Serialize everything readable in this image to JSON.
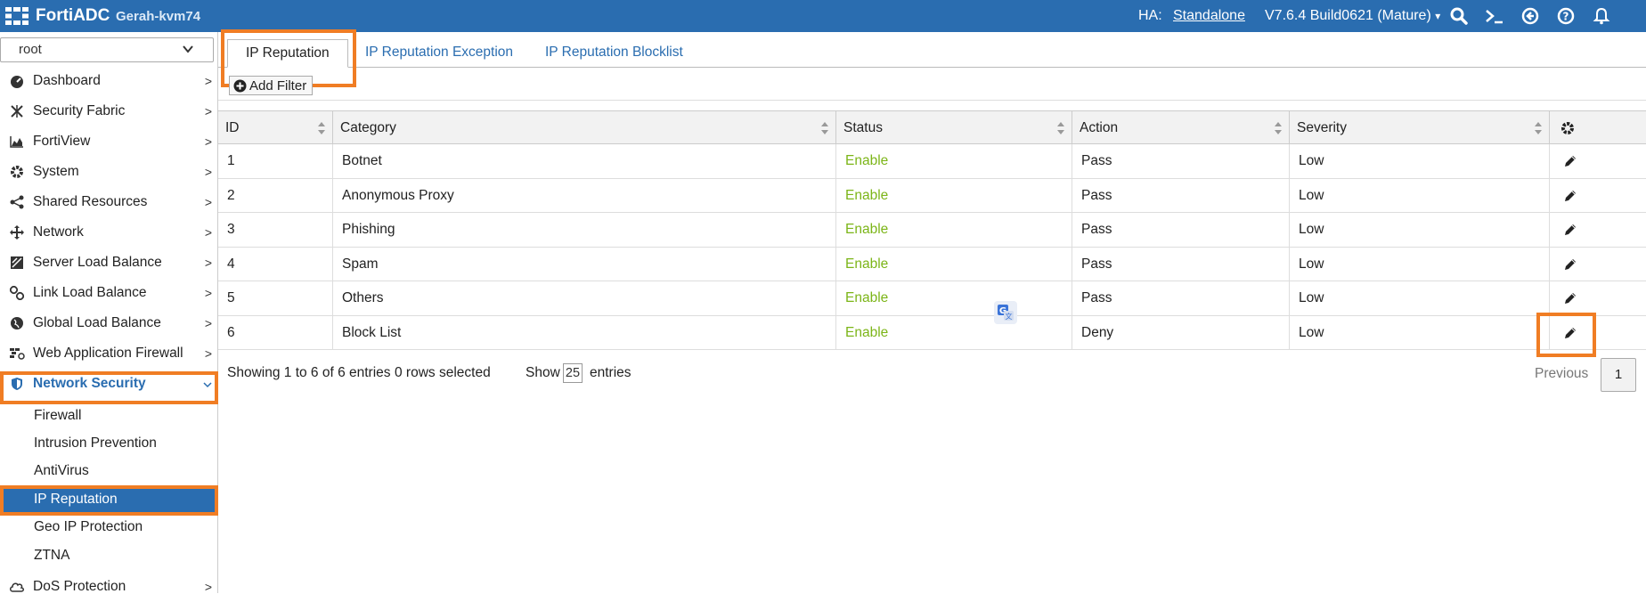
{
  "app": {
    "brand": "FortiADC",
    "hostname": "Gerah-kvm74"
  },
  "header": {
    "ha_label": "HA:",
    "ha_value": "Standalone",
    "version": "V7.6.4 Build0621 (Mature)",
    "version_caret": "▾"
  },
  "sidebar": {
    "vdom": "root",
    "items": [
      {
        "label": "Dashboard",
        "icon": "dashboard-icon"
      },
      {
        "label": "Security Fabric",
        "icon": "security-fabric-icon"
      },
      {
        "label": "FortiView",
        "icon": "chart-icon"
      },
      {
        "label": "System",
        "icon": "gear-icon"
      },
      {
        "label": "Shared Resources",
        "icon": "share-icon"
      },
      {
        "label": "Network",
        "icon": "network-icon"
      },
      {
        "label": "Server Load Balance",
        "icon": "server-lb-icon"
      },
      {
        "label": "Link Load Balance",
        "icon": "link-icon"
      },
      {
        "label": "Global Load Balance",
        "icon": "globe-icon"
      },
      {
        "label": "Web Application Firewall",
        "icon": "waf-icon"
      },
      {
        "label": "Network Security",
        "icon": "shield-icon"
      }
    ],
    "sub_items": [
      "Firewall",
      "Intrusion Prevention",
      "AntiVirus",
      "IP Reputation",
      "Geo IP Protection",
      "ZTNA"
    ],
    "after": {
      "label": "DoS Protection",
      "icon": "cloud-icon"
    }
  },
  "tabs": [
    "IP Reputation",
    "IP Reputation Exception",
    "IP Reputation Blocklist"
  ],
  "filter": {
    "label": "Add Filter"
  },
  "table": {
    "columns": [
      "ID",
      "Category",
      "Status",
      "Action",
      "Severity"
    ],
    "rows": [
      {
        "id": "1",
        "category": "Botnet",
        "status": "Enable",
        "action": "Pass",
        "severity": "Low"
      },
      {
        "id": "2",
        "category": "Anonymous Proxy",
        "status": "Enable",
        "action": "Pass",
        "severity": "Low"
      },
      {
        "id": "3",
        "category": "Phishing",
        "status": "Enable",
        "action": "Pass",
        "severity": "Low"
      },
      {
        "id": "4",
        "category": "Spam",
        "status": "Enable",
        "action": "Pass",
        "severity": "Low"
      },
      {
        "id": "5",
        "category": "Others",
        "status": "Enable",
        "action": "Pass",
        "severity": "Low"
      },
      {
        "id": "6",
        "category": "Block List",
        "status": "Enable",
        "action": "Deny",
        "severity": "Low"
      }
    ]
  },
  "footer": {
    "showing": "Showing 1 to 6 of 6 entries",
    "selected": "0 rows selected",
    "show_label": "Show",
    "page_size": "25",
    "entries_label": "entries",
    "previous": "Previous",
    "page": "1"
  },
  "colors": {
    "header_bg": "#2a6db0",
    "highlight": "#f07d24",
    "status_enable": "#7cb518"
  }
}
